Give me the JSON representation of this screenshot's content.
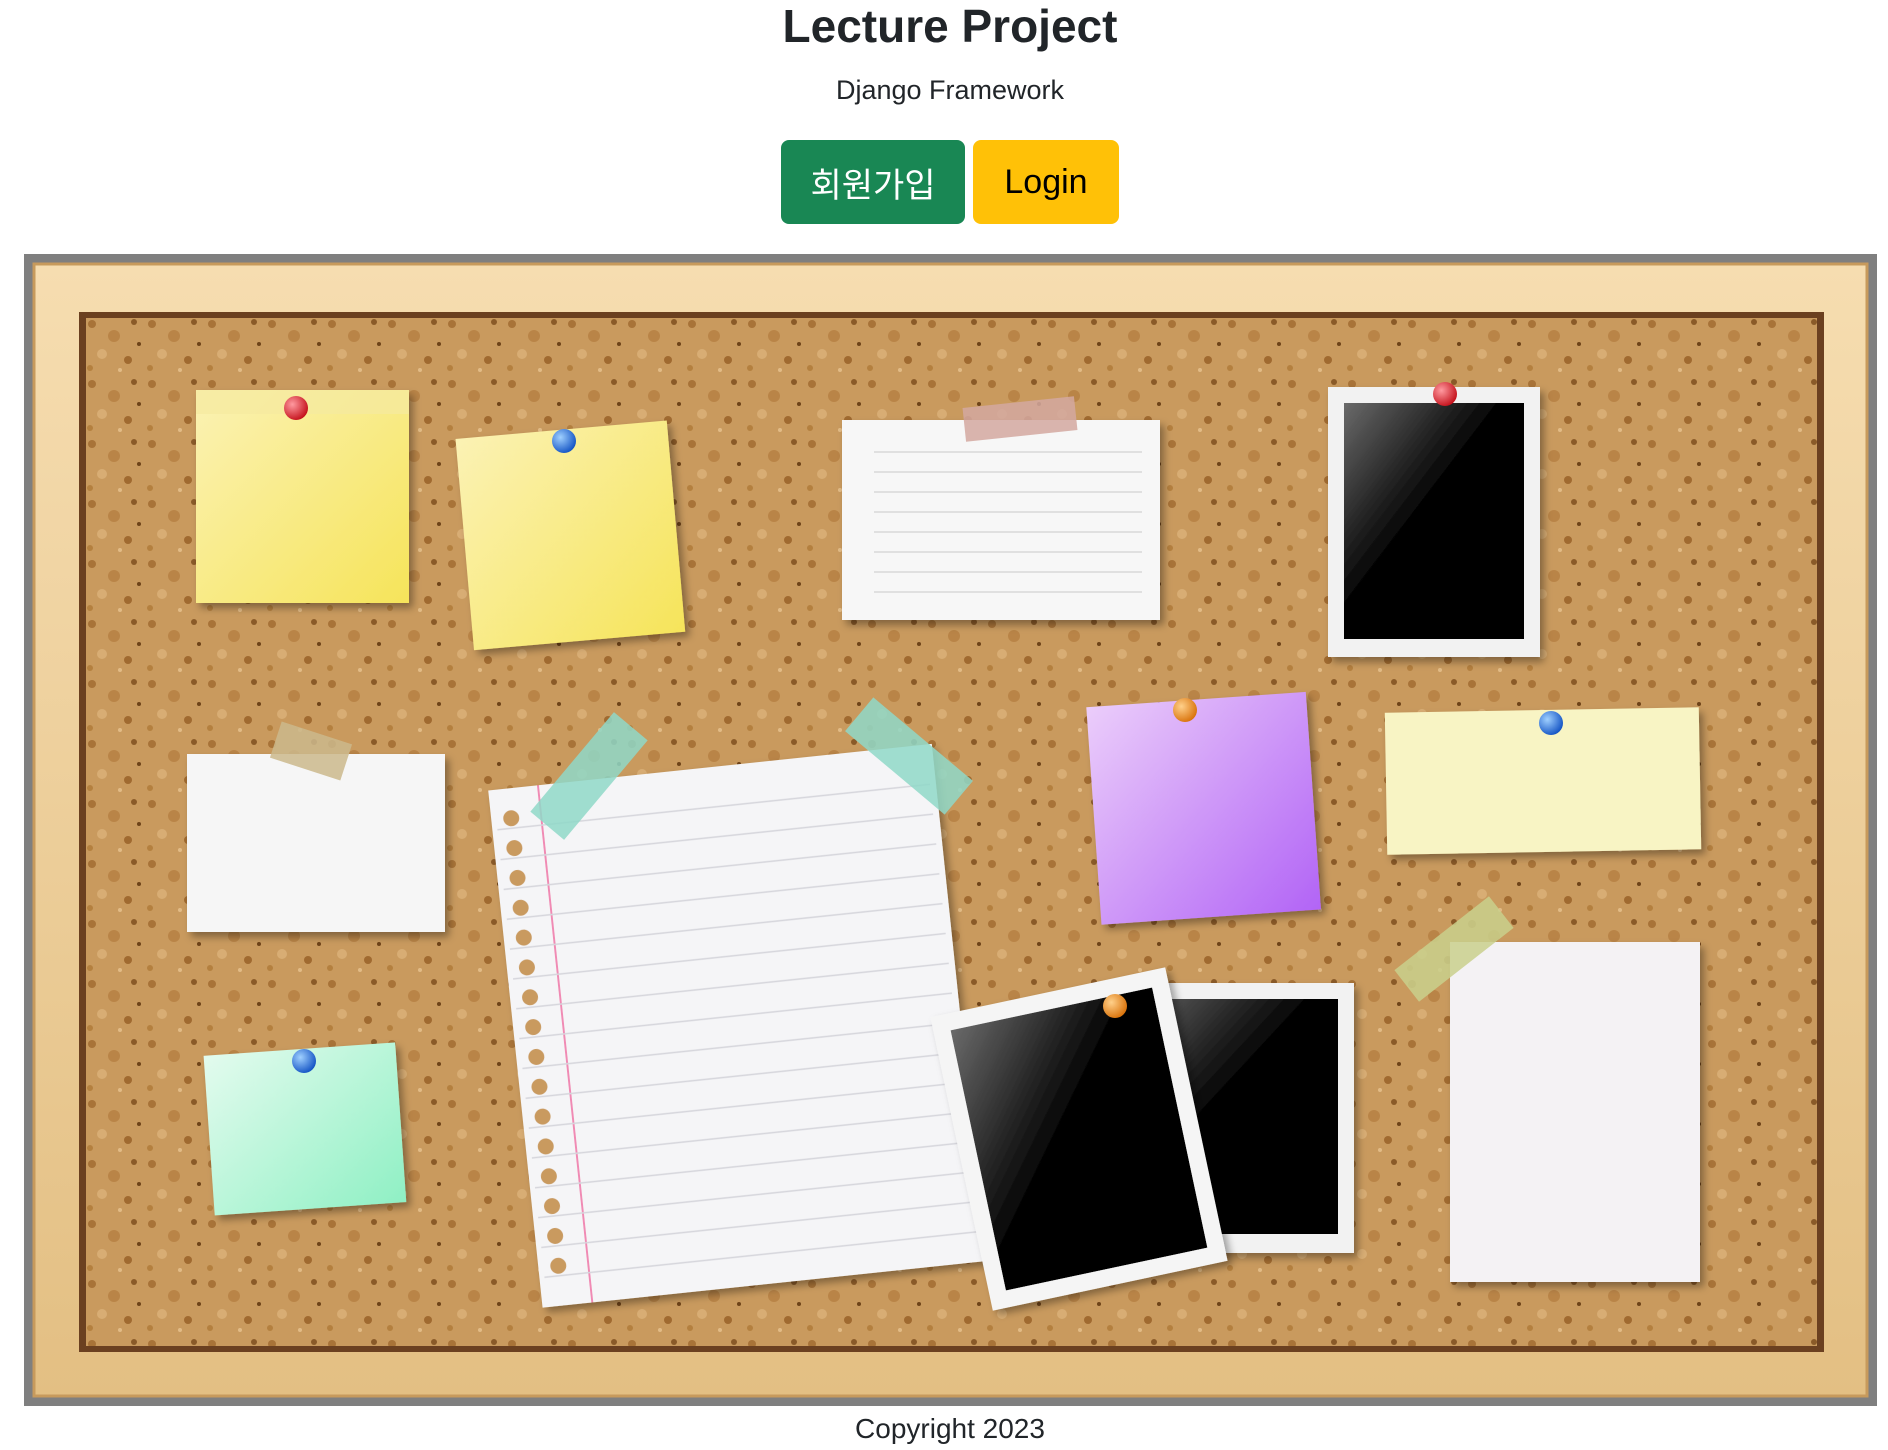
{
  "header": {
    "title": "Lecture Project",
    "subtitle": "Django Framework"
  },
  "actions": {
    "signup_label": "회원가입",
    "login_label": "Login"
  },
  "board": {
    "pin_colors": {
      "red": "#e0202a",
      "blue": "#1f6fe0",
      "orange": "#f08a10"
    }
  },
  "footer": {
    "copyright": "Copyright 2023"
  },
  "colors": {
    "signup_button": "#198754",
    "login_button": "#ffc107"
  }
}
